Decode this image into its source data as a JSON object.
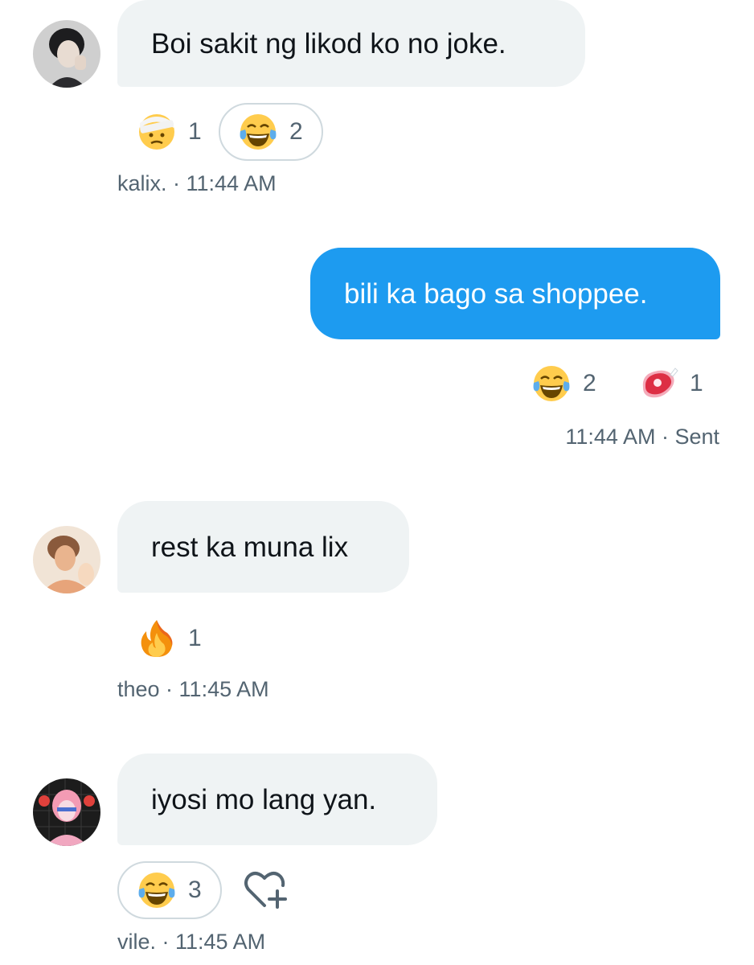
{
  "messages": [
    {
      "text": "Boi sakit ng likod ko no joke.",
      "direction": "incoming",
      "reactions": [
        {
          "icon": "bandaged-face-emoji",
          "count": "1",
          "selected": false
        },
        {
          "icon": "tears-of-joy-emoji",
          "count": "2",
          "selected": true
        }
      ],
      "meta": "kalix. · 11:44 AM"
    },
    {
      "text": "bili ka bago sa shoppee.",
      "direction": "outgoing",
      "reactions": [
        {
          "icon": "tears-of-joy-emoji",
          "count": "2",
          "selected": false
        },
        {
          "icon": "meat-emoji",
          "count": "1",
          "selected": false
        }
      ],
      "meta": "11:44 AM · Sent"
    },
    {
      "text": "rest ka muna lix",
      "direction": "incoming",
      "reactions": [
        {
          "icon": "fire-emoji",
          "count": "1",
          "selected": false
        }
      ],
      "meta": "theo · 11:45 AM"
    },
    {
      "text": "iyosi mo lang yan.",
      "direction": "incoming",
      "reactions": [
        {
          "icon": "tears-of-joy-emoji",
          "count": "3",
          "selected": true
        }
      ],
      "meta": "vile. · 11:45 AM",
      "add_reaction_icon": "heart-plus-icon"
    }
  ],
  "colors": {
    "outgoing_bubble": "#1d9bf0",
    "incoming_bubble": "#eff3f4",
    "meta_text": "#536471"
  }
}
